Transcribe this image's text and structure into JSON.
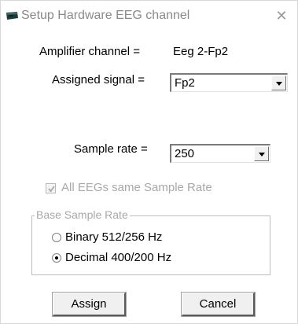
{
  "window": {
    "title": "Setup Hardware EEG channel",
    "close_glyph": "✕",
    "app_icon": "eeg-device-icon"
  },
  "amplifier": {
    "label": "Amplifier channel =",
    "value": "Eeg 2-Fp2"
  },
  "assigned_signal": {
    "label": "Assigned signal =",
    "value": "Fp2"
  },
  "sample_rate": {
    "label": "Sample rate =",
    "value": "250"
  },
  "same_rate_checkbox": {
    "label": "All EEGs same Sample Rate",
    "checked": true,
    "enabled": false
  },
  "base_sample_rate": {
    "title": "Base Sample Rate",
    "options": [
      {
        "label": "Binary 512/256 Hz",
        "selected": false
      },
      {
        "label": "Decimal 400/200 Hz",
        "selected": true
      }
    ]
  },
  "buttons": {
    "assign": "Assign",
    "cancel": "Cancel"
  }
}
